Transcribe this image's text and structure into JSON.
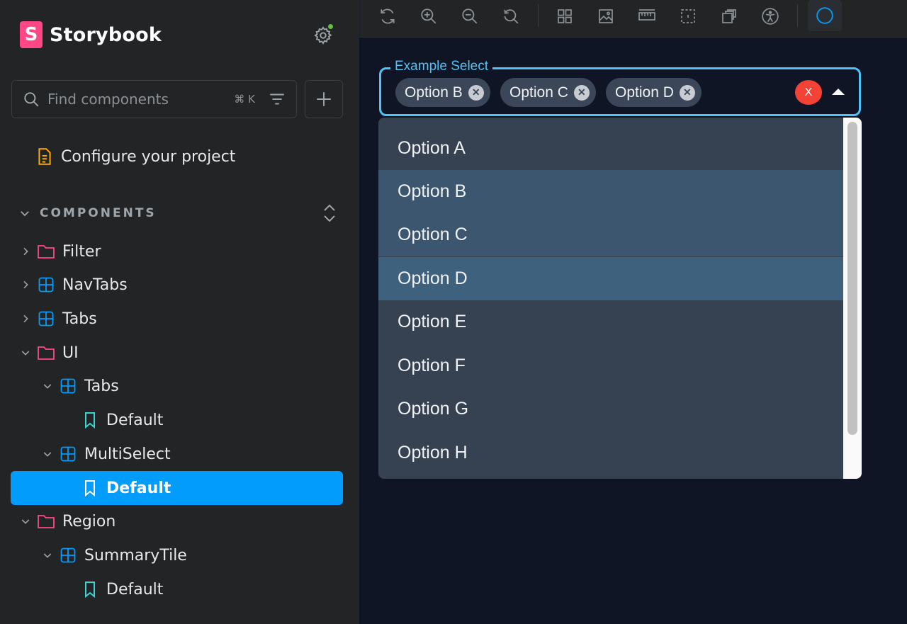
{
  "sidebar": {
    "brand": {
      "logo_letter": "S",
      "name": "Storybook"
    },
    "search": {
      "placeholder": "Find components",
      "shortcut": "⌘ K"
    },
    "configure_label": "Configure your project",
    "section_label": "COMPONENTS",
    "items": [
      {
        "label": "Filter",
        "icon": "folder-icon",
        "expanded": false
      },
      {
        "label": "NavTabs",
        "icon": "component-icon",
        "expanded": false
      },
      {
        "label": "Tabs",
        "icon": "component-icon",
        "expanded": false
      },
      {
        "label": "UI",
        "icon": "folder-icon",
        "expanded": true
      },
      {
        "label": "Tabs",
        "icon": "component-icon",
        "expanded": true
      },
      {
        "label": "Default",
        "icon": "story-icon"
      },
      {
        "label": "MultiSelect",
        "icon": "component-icon",
        "expanded": true
      },
      {
        "label": "Default",
        "icon": "story-icon",
        "selected": true
      },
      {
        "label": "Region",
        "icon": "folder-icon",
        "expanded": true
      },
      {
        "label": "SummaryTile",
        "icon": "component-icon",
        "expanded": true
      },
      {
        "label": "Default",
        "icon": "story-icon"
      }
    ]
  },
  "canvas": {
    "select": {
      "label": "Example Select",
      "chips": [
        "Option B",
        "Option C",
        "Option D"
      ],
      "clear_label": "X"
    },
    "options": [
      "Option A",
      "Option B",
      "Option C",
      "Option D",
      "Option E",
      "Option F",
      "Option G",
      "Option H"
    ]
  },
  "colors": {
    "accent": "#029cfd",
    "brand": "#ff4785",
    "select_border": "#4fc3f7",
    "clear": "#f44336",
    "status_dot": "#66bf3c"
  }
}
